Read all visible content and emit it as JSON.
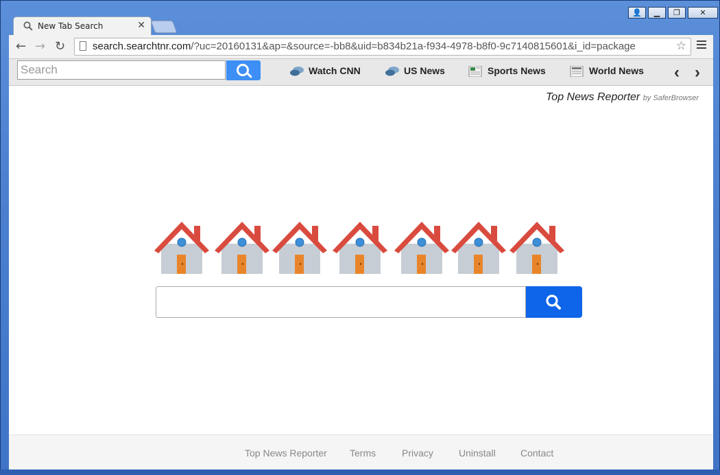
{
  "tab": {
    "title": "New Tab Search"
  },
  "address": {
    "host": "search.searchtnr.com",
    "path": "/?uc=20160131&ap=&source=-bb8&uid=b834b21a-f934-4978-b8f0-9c7140815601&i_id=package"
  },
  "extbar": {
    "search_placeholder": "Search",
    "links": [
      {
        "label": "Watch CNN",
        "icon": "news-chat-icon"
      },
      {
        "label": "US News",
        "icon": "news-chat-icon"
      },
      {
        "label": "Sports News",
        "icon": "newspaper-icon"
      },
      {
        "label": "World News",
        "icon": "newspaper-icon"
      }
    ]
  },
  "brand": {
    "name": "Top News Reporter",
    "by": "by SaferBrowser"
  },
  "footer": {
    "links": [
      "Top News Reporter",
      "Terms",
      "Privacy",
      "Uninstall",
      "Contact"
    ]
  },
  "colors": {
    "search_button": "#0f65e9",
    "ext_button": "#3d8ff5",
    "roof": "#d94b3f",
    "house_wall": "#c7cdd4",
    "door": "#e8852a",
    "window": "#3c8fd8"
  }
}
